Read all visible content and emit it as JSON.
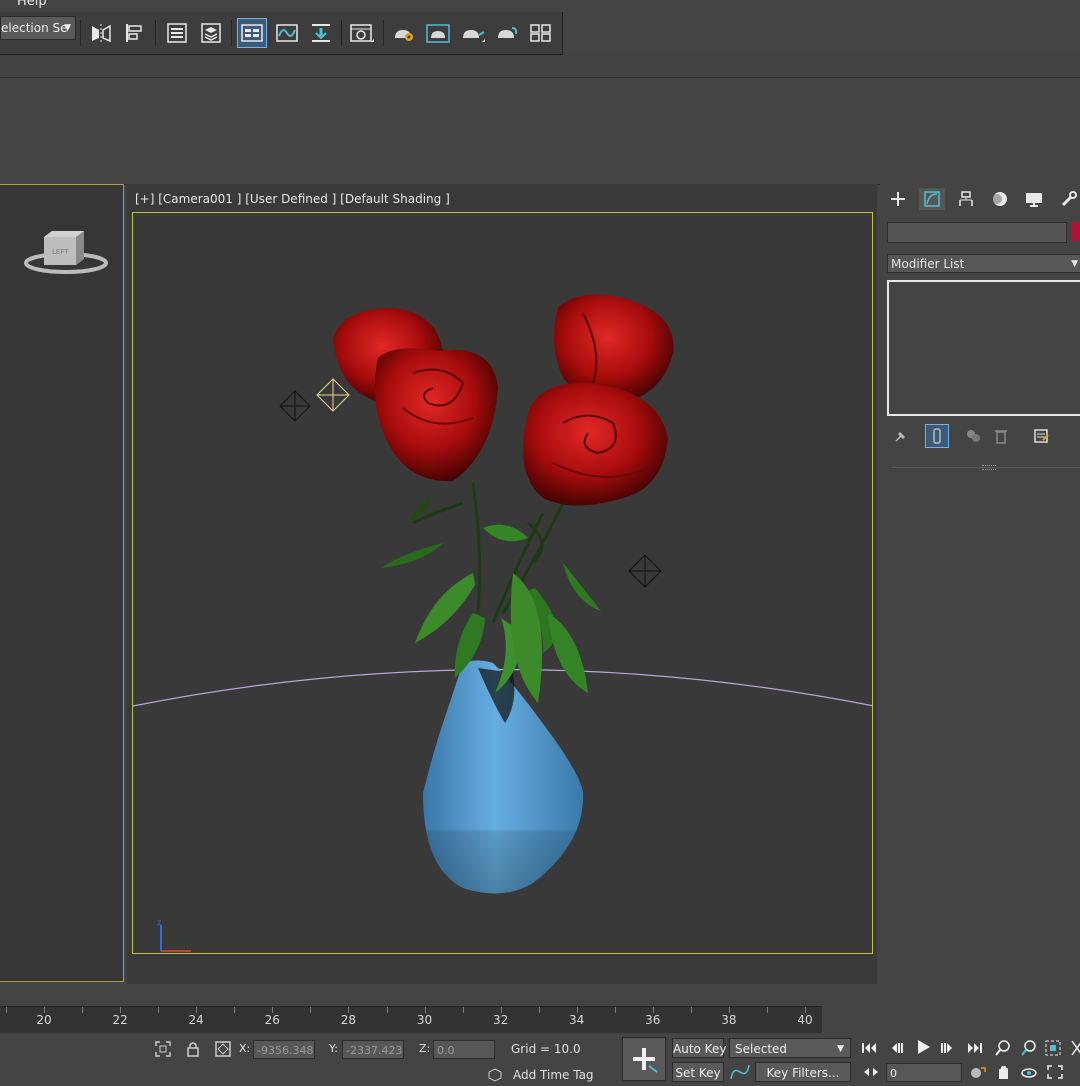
{
  "menu": {
    "help": "Help"
  },
  "toolbar": {
    "selection_set_label": "election Se",
    "tools": [
      "mirror-icon",
      "align-icon",
      "scene-explorer-icon",
      "layer-explorer-icon",
      "toggle-ribbon-icon",
      "curve-editor-icon",
      "schematic-view-icon",
      "material-editor-icon",
      "render-setup-icon",
      "rendered-frame-window-icon",
      "render-production-icon",
      "render-iterative-icon",
      "render-in-cloud-icon",
      "arnold-icon"
    ]
  },
  "viewport": {
    "label": "[+] [Camera001 ] [User Defined ] [Default Shading ]",
    "viewcube_face": "LEFT"
  },
  "command_panel": {
    "tabs": [
      "create-icon",
      "modify-icon",
      "hierarchy-icon",
      "motion-icon",
      "display-icon",
      "utilities-icon"
    ],
    "name_value": "",
    "color_swatch": "#b0103a",
    "modifier_list": "Modifier List"
  },
  "timeline": {
    "numbers": [
      "20",
      "22",
      "24",
      "26",
      "28",
      "30",
      "32",
      "34",
      "36",
      "38",
      "40"
    ]
  },
  "status": {
    "x_label": "X:",
    "x_value": "-9356.348",
    "y_label": "Y:",
    "y_value": "-2337.423",
    "z_label": "Z:",
    "z_value": "0.0",
    "grid": "Grid = 10.0",
    "add_time_tag": "Add Time Tag",
    "auto_key": "Auto Key",
    "set_key": "Set Key",
    "selected": "Selected",
    "key_filters": "Key Filters...",
    "frame": "0"
  },
  "colors": {
    "accent_active": "#7ab0e0",
    "viewport_border": "#c8c23a",
    "rose_red": "#c81818",
    "vase_blue": "#5a9ed0",
    "leaf_green": "#3c8a2a"
  }
}
